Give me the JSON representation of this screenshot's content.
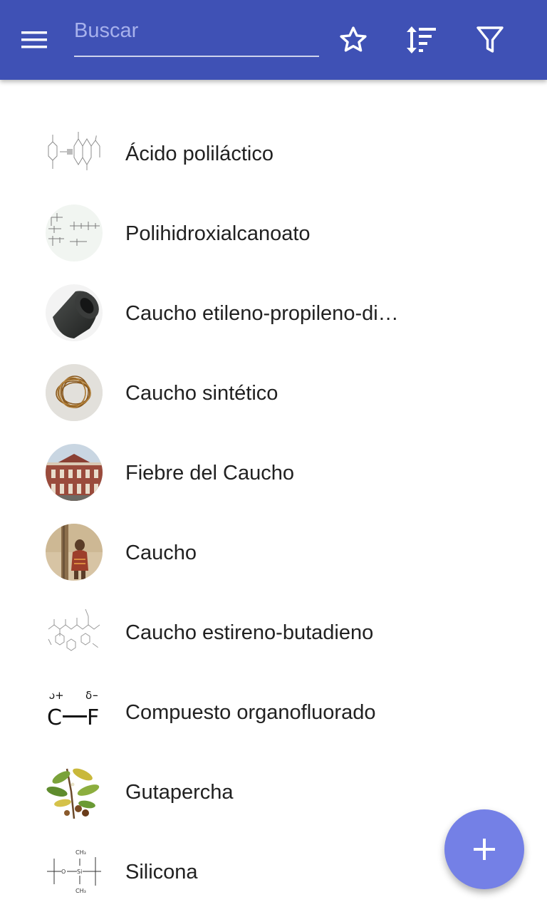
{
  "appbar": {
    "color": "#3f51b5",
    "menu_icon": "hamburger-menu-icon",
    "search": {
      "placeholder": "Buscar",
      "value": ""
    },
    "actions": [
      {
        "icon": "star-outline-icon"
      },
      {
        "icon": "sort-icon"
      },
      {
        "icon": "filter-icon"
      }
    ]
  },
  "items": [
    {
      "label": "Ácido poliláctico",
      "thumbnail": "chemical-structure"
    },
    {
      "label": "Polihidroxialcanoato",
      "thumbnail": "chemical-structure"
    },
    {
      "label": "Caucho etileno-propileno-di…",
      "thumbnail": "rubber-cylinder-photo"
    },
    {
      "label": "Caucho sintético",
      "thumbnail": "rubber-bands-photo"
    },
    {
      "label": "Fiebre del Caucho",
      "thumbnail": "building-photo"
    },
    {
      "label": "Caucho",
      "thumbnail": "rubber-tapping-photo"
    },
    {
      "label": "Caucho estireno-butadieno",
      "thumbnail": "chemical-structure"
    },
    {
      "label": "Compuesto organofluorado",
      "thumbnail": "c-f-bond-diagram"
    },
    {
      "label": "Gutapercha",
      "thumbnail": "botanical-illustration"
    },
    {
      "label": "Silicona",
      "thumbnail": "siloxane-structure"
    }
  ],
  "thumb_text": {
    "delta_plus": "δ+",
    "delta_minus": "δ−",
    "c": "C",
    "f": "F",
    "ch3": "CH₃",
    "o": "O",
    "si": "Si"
  },
  "fab": {
    "icon": "plus-icon",
    "color": "#7480e6"
  }
}
